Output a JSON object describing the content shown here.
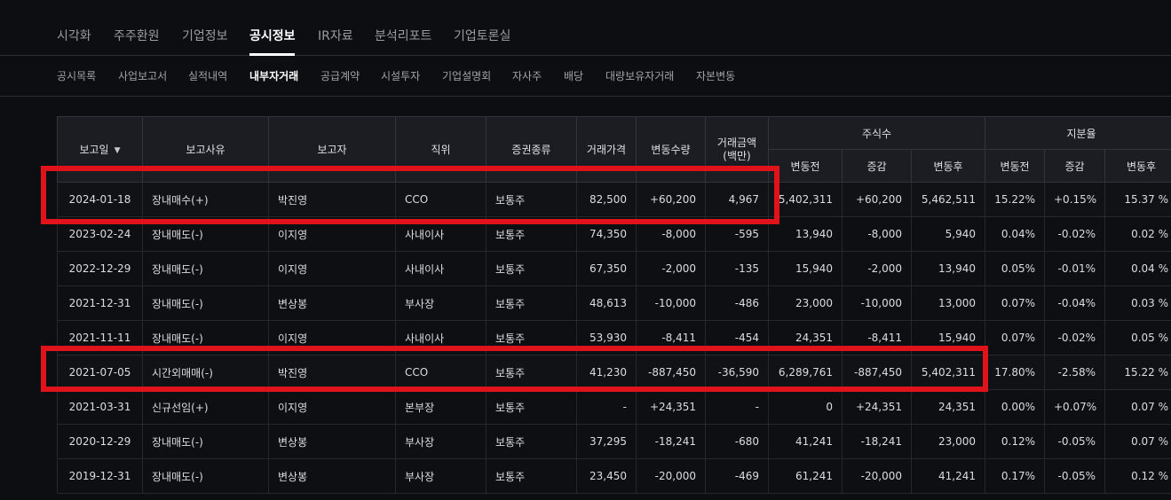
{
  "main_tabs": [
    "시각화",
    "주주환원",
    "기업정보",
    "공시정보",
    "IR자료",
    "분석리포트",
    "기업토론실"
  ],
  "main_active": 3,
  "sub_tabs": [
    "공시목록",
    "사업보고서",
    "실적내역",
    "내부자거래",
    "공급계약",
    "시설투자",
    "기업설명회",
    "자사주",
    "배당",
    "대량보유자거래",
    "자본변동"
  ],
  "sub_active": 3,
  "table": {
    "headers": {
      "report_date": "보고일",
      "reason": "보고사유",
      "reporter": "보고자",
      "position": "직위",
      "security_type": "증권종류",
      "trade_price": "거래가격",
      "change_qty": "변동수량",
      "trade_amount_line1": "거래금액",
      "trade_amount_line2": "(백만)",
      "shares": "주식수",
      "stake": "지분율",
      "before": "변동전",
      "delta": "증감",
      "after": "변동후"
    },
    "rows": [
      [
        "2024-01-18",
        "장내매수(+)",
        "박진영",
        "CCO",
        "보통주",
        "82,500",
        "+60,200",
        "4,967",
        "5,402,311",
        "+60,200",
        "5,462,511",
        "15.22%",
        "+0.15%",
        "15.37 %"
      ],
      [
        "2023-02-24",
        "장내매도(-)",
        "이지영",
        "사내이사",
        "보통주",
        "74,350",
        "-8,000",
        "-595",
        "13,940",
        "-8,000",
        "5,940",
        "0.04%",
        "-0.02%",
        "0.02 %"
      ],
      [
        "2022-12-29",
        "장내매도(-)",
        "이지영",
        "사내이사",
        "보통주",
        "67,350",
        "-2,000",
        "-135",
        "15,940",
        "-2,000",
        "13,940",
        "0.05%",
        "-0.01%",
        "0.04 %"
      ],
      [
        "2021-12-31",
        "장내매도(-)",
        "변상봉",
        "부사장",
        "보통주",
        "48,613",
        "-10,000",
        "-486",
        "23,000",
        "-10,000",
        "13,000",
        "0.07%",
        "-0.04%",
        "0.03 %"
      ],
      [
        "2021-11-11",
        "장내매도(-)",
        "이지영",
        "사내이사",
        "보통주",
        "53,930",
        "-8,411",
        "-454",
        "24,351",
        "-8,411",
        "15,940",
        "0.07%",
        "-0.02%",
        "0.05 %"
      ],
      [
        "2021-07-05",
        "시간외매매(-)",
        "박진영",
        "CCO",
        "보통주",
        "41,230",
        "-887,450",
        "-36,590",
        "6,289,761",
        "-887,450",
        "5,402,311",
        "17.80%",
        "-2.58%",
        "15.22 %"
      ],
      [
        "2021-03-31",
        "신규선임(+)",
        "이지영",
        "본부장",
        "보통주",
        "-",
        "+24,351",
        "-",
        "0",
        "+24,351",
        "24,351",
        "0.00%",
        "+0.07%",
        "0.07 %"
      ],
      [
        "2020-12-29",
        "장내매도(-)",
        "변상봉",
        "부사장",
        "보통주",
        "37,295",
        "-18,241",
        "-680",
        "41,241",
        "-18,241",
        "23,000",
        "0.12%",
        "-0.05%",
        "0.07 %"
      ],
      [
        "2019-12-31",
        "장내매도(-)",
        "변상봉",
        "부사장",
        "보통주",
        "23,450",
        "-20,000",
        "-469",
        "61,241",
        "-20,000",
        "41,241",
        "0.17%",
        "-0.05%",
        "0.12 %"
      ]
    ],
    "highlighted_rows": [
      0,
      5
    ]
  },
  "colors": {
    "background": "#0d0e11",
    "header_bg": "#1b1d22",
    "highlight_box": "#e0131b",
    "active_text": "#ffffff",
    "inactive_text": "#9a9ca2"
  },
  "icons": {
    "sort": "chevron-down-icon"
  }
}
